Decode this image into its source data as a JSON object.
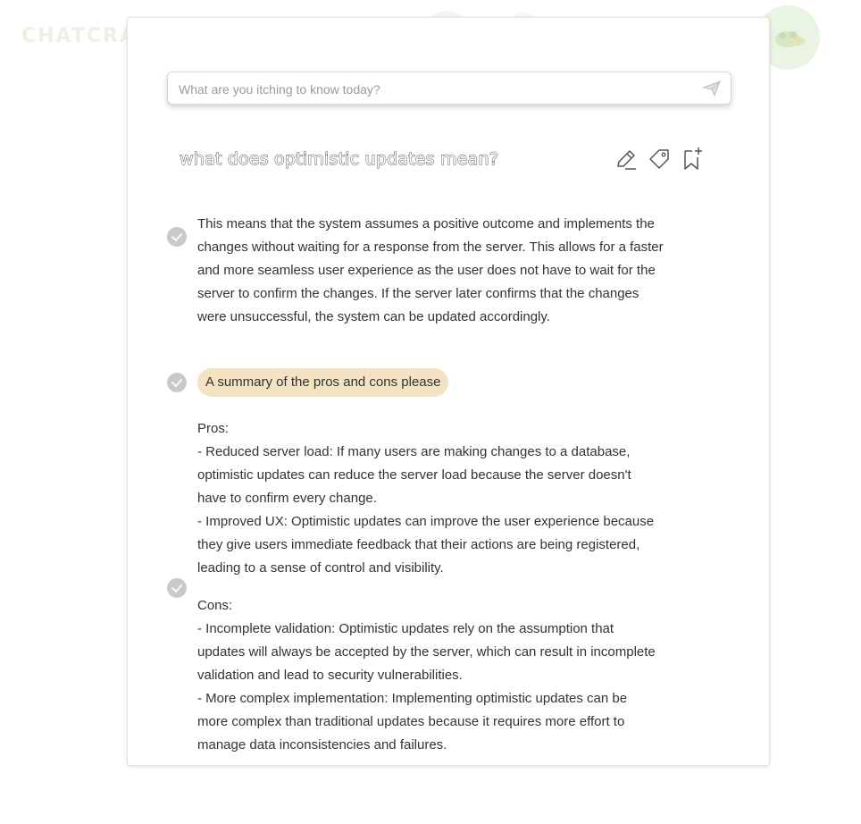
{
  "background": {
    "logo_text": "CHATCRA"
  },
  "search": {
    "placeholder": "What are you itching to know today?",
    "value": ""
  },
  "conversation": {
    "question": "what does optimistic updates mean?",
    "first_answer_lines": [
      "This means that the system assumes a positive outcome and implements the",
      "changes without waiting for a response from the server. This allows for a faster",
      "and more seamless user experience as the user does not have to wait for the",
      "server to confirm the changes. If the server later confirms that the changes",
      "were unsuccessful, the system can be updated accordingly."
    ],
    "follow_up": "A summary of the pros and cons please",
    "second_answer_lines": [
      "Pros:",
      "- Reduced server load: If many users are making changes to a database,",
      "optimistic updates can reduce the server load because the server doesn't",
      "have to confirm every change.",
      "- Improved UX: Optimistic updates can improve the user experience because",
      "they give users immediate feedback that their actions are being registered,",
      "leading to a sense of control and visibility.",
      "",
      "Cons:",
      "- Incomplete validation: Optimistic updates rely on the assumption that",
      "updates will always be accepted by the server, which can result in incomplete",
      "validation and lead to security vulnerabilities.",
      "- More complex implementation: Implementing optimistic updates can be",
      "more complex than traditional updates because it requires more effort to",
      "manage data inconsistencies and failures."
    ]
  },
  "icons": {
    "send": "send-icon",
    "edit": "pencil-icon",
    "tag": "tag-icon",
    "bookmark": "bookmark-add-icon",
    "check": "check-circle-icon"
  },
  "colors": {
    "pill_bg": "#f3e3c2",
    "check_bg": "#c9c9c9"
  }
}
